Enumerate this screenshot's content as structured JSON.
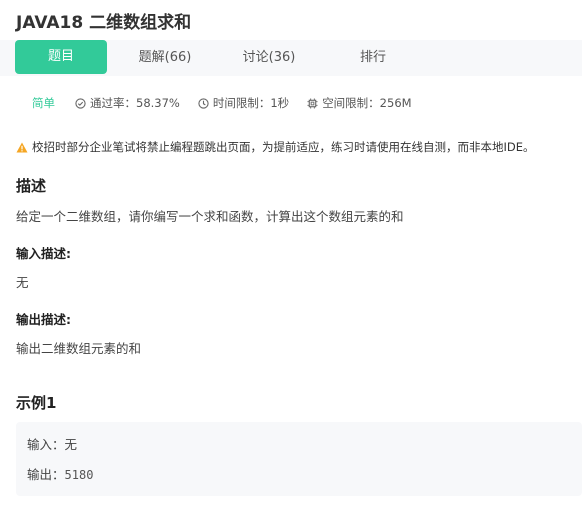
{
  "problem": {
    "title": "JAVA18  二维数组求和"
  },
  "tabs": [
    {
      "label": "题目",
      "active": true
    },
    {
      "label": "题解(66)",
      "active": false
    },
    {
      "label": "讨论(36)",
      "active": false
    },
    {
      "label": "排行",
      "active": false
    }
  ],
  "meta": {
    "difficulty": "简单",
    "pass_rate": "通过率：58.37%",
    "time_limit": "时间限制：1秒",
    "space_limit": "空间限制：256M"
  },
  "notice": "校招时部分企业笔试将禁止编程题跳出页面，为提前适应，练习时请使用在线自测，而非本地IDE。",
  "description": {
    "heading": "描述",
    "text": "给定一个二维数组，请你编写一个求和函数，计算出这个数组元素的和"
  },
  "input_desc": {
    "heading": "输入描述:",
    "text": "无"
  },
  "output_desc": {
    "heading": "输出描述:",
    "text": "输出二维数组元素的和"
  },
  "example": {
    "heading": "示例1",
    "input_label": "输入：",
    "input_value": "无",
    "output_label": "输出：",
    "output_value": "5180"
  },
  "colors": {
    "accent": "#32ca99",
    "warning": "#f5a623",
    "panel_bg": "#f7f8fa"
  }
}
